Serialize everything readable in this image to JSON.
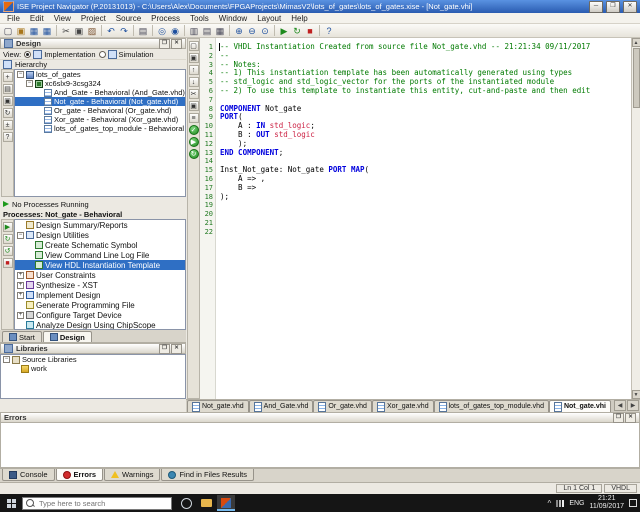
{
  "window": {
    "title": "ISE Project Navigator (P.20131013) - C:\\Users\\Alex\\Documents\\FPGAProjects\\MimasV2\\lots_of_gates\\lots_of_gates.xise - [Not_gate.vhi]",
    "minimize_glyph": "─",
    "maximize_glyph": "❒",
    "close_glyph": "✕"
  },
  "panel_buttons": {
    "float": "❒",
    "close": "✕"
  },
  "scroll": {
    "up": "▲",
    "down": "▼",
    "left": "◀",
    "right": "▶"
  },
  "menu": {
    "items": [
      "File",
      "Edit",
      "View",
      "Project",
      "Source",
      "Process",
      "Tools",
      "Window",
      "Layout",
      "Help"
    ]
  },
  "toolbar": {
    "icons": [
      {
        "name": "new-file-icon",
        "g": "▢",
        "c": "#445"
      },
      {
        "name": "open-file-icon",
        "g": "▣",
        "c": "#a8761a"
      },
      {
        "name": "save-icon",
        "g": "▦",
        "c": "#1d4f9e"
      },
      {
        "name": "save-all-icon",
        "g": "▦",
        "c": "#1d4f9e"
      },
      {
        "name": "separator"
      },
      {
        "name": "cut-icon",
        "g": "✂",
        "c": "#444"
      },
      {
        "name": "copy-icon",
        "g": "▣",
        "c": "#444"
      },
      {
        "name": "paste-icon",
        "g": "▨",
        "c": "#7a5230"
      },
      {
        "name": "separator"
      },
      {
        "name": "undo-icon",
        "g": "↶",
        "c": "#1d4f9e"
      },
      {
        "name": "redo-icon",
        "g": "↷",
        "c": "#1d4f9e"
      },
      {
        "name": "separator"
      },
      {
        "name": "print-icon",
        "g": "▤",
        "c": "#445"
      },
      {
        "name": "separator"
      },
      {
        "name": "find-icon",
        "g": "◎",
        "c": "#1d4f9e"
      },
      {
        "name": "find-in-files-icon",
        "g": "◉",
        "c": "#1d4f9e"
      },
      {
        "name": "separator"
      },
      {
        "name": "new-window-icon",
        "g": "▥",
        "c": "#445"
      },
      {
        "name": "cascade-windows-icon",
        "g": "▤",
        "c": "#445"
      },
      {
        "name": "tile-windows-icon",
        "g": "▦",
        "c": "#445"
      },
      {
        "name": "separator"
      },
      {
        "name": "zoom-in-icon",
        "g": "⊕",
        "c": "#1d4f9e"
      },
      {
        "name": "zoom-out-icon",
        "g": "⊖",
        "c": "#1d4f9e"
      },
      {
        "name": "zoom-full-icon",
        "g": "⊙",
        "c": "#1d4f9e"
      },
      {
        "name": "separator"
      },
      {
        "name": "run-icon",
        "g": "▶",
        "c": "#1d8a1d"
      },
      {
        "name": "rerun-icon",
        "g": "↻",
        "c": "#1d8a1d"
      },
      {
        "name": "stop-icon",
        "g": "■",
        "c": "#c02020"
      },
      {
        "name": "separator"
      },
      {
        "name": "help-icon",
        "g": "?",
        "c": "#1d4f9e"
      }
    ]
  },
  "design": {
    "panel_title": "Design",
    "view_label": "View:",
    "options": [
      {
        "label": "Implementation",
        "checked": true
      },
      {
        "label": "Simulation",
        "checked": false
      }
    ],
    "hierarchy_label": "Hierarchy",
    "strip": [
      {
        "name": "new-source-icon",
        "g": "+"
      },
      {
        "name": "view-design-summary-icon",
        "g": "▤"
      },
      {
        "name": "show-all-files-icon",
        "g": "▣"
      },
      {
        "name": "refresh-hierarchy-icon",
        "g": "↻"
      },
      {
        "name": "expand-all-icon",
        "g": "±"
      },
      {
        "name": "hierarchy-help-icon",
        "g": "?"
      }
    ],
    "tree": [
      {
        "label": "lots_of_gates",
        "level": 0,
        "icon": "prj",
        "exp": "minus"
      },
      {
        "label": "xc6slx9-3csg324",
        "level": 1,
        "icon": "chip",
        "exp": "minus"
      },
      {
        "label": "And_Gate - Behavioral (And_Gate.vhd)",
        "level": 2,
        "icon": "vhd"
      },
      {
        "label": "Not_gate - Behavioral (Not_gate.vhd)",
        "level": 2,
        "icon": "vhd",
        "selected": true
      },
      {
        "label": "Or_gate - Behavioral (Or_gate.vhd)",
        "level": 2,
        "icon": "vhd"
      },
      {
        "label": "Xor_gate - Behavioral (Xor_gate.vhd)",
        "level": 2,
        "icon": "vhd"
      },
      {
        "label": "lots_of_gates_top_module - Behavioral (lots_of_gates_top_module.vhd)",
        "level": 2,
        "icon": "vhd"
      }
    ]
  },
  "processes": {
    "status": "No Processes Running",
    "panel_title": "Processes: Not_gate - Behavioral",
    "strip": [
      {
        "name": "run-process-icon",
        "g": "▶",
        "c": "#1d8a1d"
      },
      {
        "name": "rerun-process-icon",
        "g": "↻",
        "c": "#1d8a1d"
      },
      {
        "name": "rerun-all-icon",
        "g": "↺",
        "c": "#1d8a1d"
      },
      {
        "name": "stop-process-icon",
        "g": "■",
        "c": "#c02020"
      }
    ],
    "tree": [
      {
        "label": "Design Summary/Reports",
        "level": 0,
        "icon": "rpt"
      },
      {
        "label": "Design Utilities",
        "level": 0,
        "icon": "utl",
        "exp": "minus"
      },
      {
        "label": "Create Schematic Symbol",
        "level": 1,
        "icon": "prc"
      },
      {
        "label": "View Command Line Log File",
        "level": 1,
        "icon": "prc"
      },
      {
        "label": "View HDL Instantiation Template",
        "level": 1,
        "icon": "prc",
        "selected": true
      },
      {
        "label": "User Constraints",
        "level": 0,
        "icon": "cst",
        "exp": "plus"
      },
      {
        "label": "Synthesize - XST",
        "level": 0,
        "icon": "syn",
        "exp": "plus"
      },
      {
        "label": "Implement Design",
        "level": 0,
        "icon": "imp",
        "exp": "plus"
      },
      {
        "label": "Generate Programming File",
        "level": 0,
        "icon": "gen"
      },
      {
        "label": "Configure Target Device",
        "level": 0,
        "icon": "cfg",
        "exp": "plus"
      },
      {
        "label": "Analyze Design Using ChipScope",
        "level": 0,
        "icon": "ana"
      }
    ]
  },
  "panel_tabs": [
    {
      "label": "Start",
      "active": false
    },
    {
      "label": "Design",
      "active": true
    }
  ],
  "libraries": {
    "panel_title": "Libraries",
    "tree": [
      {
        "label": "Source Libraries",
        "level": 0,
        "icon": "lib",
        "exp": "minus"
      },
      {
        "label": "work",
        "level": 1,
        "icon": "fld"
      }
    ]
  },
  "editor": {
    "strip": [
      {
        "name": "select-tool-icon",
        "g": "▢"
      },
      {
        "name": "toggle-bookmark-icon",
        "g": "▣"
      },
      {
        "name": "prev-bookmark-icon",
        "g": "↑"
      },
      {
        "name": "next-bookmark-icon",
        "g": "↓"
      },
      {
        "name": "cut-line-icon",
        "g": "✂"
      },
      {
        "name": "copy-line-icon",
        "g": "▣"
      },
      {
        "name": "indent-icon",
        "g": "≡"
      },
      {
        "name": "check-syntax-icon",
        "g": "✓",
        "green": true
      },
      {
        "name": "run-check-icon",
        "g": "▶",
        "green": true
      },
      {
        "name": "refresh-view-icon",
        "g": "↻",
        "green": true
      }
    ],
    "lines": [
      {
        "n": 1,
        "seg": [
          {
            "c": "c",
            "t": "-- VHDL Instantiation Created from source file Not_gate.vhd -- 21:21:34 09/11/2017"
          }
        ]
      },
      {
        "n": 2,
        "seg": [
          {
            "c": "c",
            "t": "--"
          }
        ]
      },
      {
        "n": 3,
        "seg": [
          {
            "c": "c",
            "t": "-- Notes:"
          }
        ]
      },
      {
        "n": 4,
        "seg": [
          {
            "c": "c",
            "t": "-- 1) This instantiation template has been automatically generated using types"
          }
        ]
      },
      {
        "n": 5,
        "seg": [
          {
            "c": "c",
            "t": "-- std_logic and std_logic_vector for the ports of the instantiated module"
          }
        ]
      },
      {
        "n": 6,
        "seg": [
          {
            "c": "c",
            "t": "-- 2) To use this template to instantiate this entity, cut-and-paste and then edit"
          }
        ]
      },
      {
        "n": 7,
        "seg": []
      },
      {
        "n": 8,
        "seg": [
          {
            "c": "k",
            "t": "COMPONENT"
          },
          {
            "c": "p",
            "t": " Not_gate"
          }
        ]
      },
      {
        "n": 9,
        "seg": [
          {
            "c": "k",
            "t": "PORT"
          },
          {
            "c": "p",
            "t": "("
          }
        ]
      },
      {
        "n": 10,
        "seg": [
          {
            "c": "p",
            "t": "    A : "
          },
          {
            "c": "k",
            "t": "IN"
          },
          {
            "c": "p",
            "t": " "
          },
          {
            "c": "t",
            "t": "std_logic"
          },
          {
            "c": "p",
            "t": ";"
          }
        ]
      },
      {
        "n": 11,
        "seg": [
          {
            "c": "p",
            "t": "    B : "
          },
          {
            "c": "k",
            "t": "OUT"
          },
          {
            "c": "p",
            "t": " "
          },
          {
            "c": "t",
            "t": "std_logic"
          }
        ]
      },
      {
        "n": 12,
        "seg": [
          {
            "c": "p",
            "t": "    );"
          }
        ]
      },
      {
        "n": 13,
        "seg": [
          {
            "c": "k",
            "t": "END COMPONENT"
          },
          {
            "c": "p",
            "t": ";"
          }
        ]
      },
      {
        "n": 14,
        "seg": []
      },
      {
        "n": 15,
        "seg": [
          {
            "c": "p",
            "t": "Inst_Not_gate: Not_gate "
          },
          {
            "c": "k",
            "t": "PORT MAP"
          },
          {
            "c": "p",
            "t": "("
          }
        ]
      },
      {
        "n": 16,
        "seg": [
          {
            "c": "p",
            "t": "    A => ,"
          }
        ]
      },
      {
        "n": 17,
        "seg": [
          {
            "c": "p",
            "t": "    B => "
          }
        ]
      },
      {
        "n": 18,
        "seg": [
          {
            "c": "p",
            "t": ");"
          }
        ]
      },
      {
        "n": 19,
        "seg": []
      },
      {
        "n": 20,
        "seg": []
      },
      {
        "n": 21,
        "seg": []
      },
      {
        "n": 22,
        "seg": []
      }
    ]
  },
  "file_tabs": [
    {
      "label": "Not_gate.vhd",
      "active": false
    },
    {
      "label": "And_Gate.vhd",
      "active": false
    },
    {
      "label": "Or_gate.vhd",
      "active": false
    },
    {
      "label": "Xor_gate.vhd",
      "active": false
    },
    {
      "label": "lots_of_gates_top_module.vhd",
      "active": false
    },
    {
      "label": "Not_gate.vhi",
      "active": true
    }
  ],
  "errors_panel": {
    "title": "Errors"
  },
  "console_tabs": [
    {
      "label": "Console",
      "icon": "console",
      "active": false
    },
    {
      "label": "Errors",
      "icon": "error",
      "active": true
    },
    {
      "label": "Warnings",
      "icon": "warning",
      "active": false
    },
    {
      "label": "Find in Files Results",
      "icon": "find",
      "active": false
    }
  ],
  "status_bar": {
    "position": "Ln 1 Col 1",
    "language": "VHDL"
  },
  "taskbar": {
    "search_placeholder": "Type here to search",
    "apps": [
      {
        "name": "cortana-app-icon",
        "cls": "ai-circle",
        "active": false
      },
      {
        "name": "file-explorer-app-icon",
        "cls": "ai-folder",
        "active": false
      },
      {
        "name": "ise-app-icon",
        "cls": "ai-ise",
        "active": true
      }
    ],
    "tray": {
      "lang": "ENG",
      "time": "21:21",
      "date": "11/09/2017"
    }
  }
}
